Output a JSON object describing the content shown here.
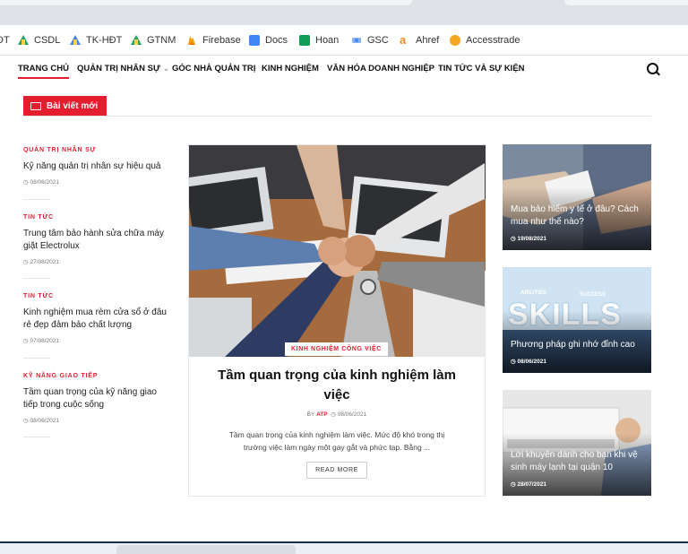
{
  "bookmarks": [
    {
      "label": "ĐT",
      "icon": "none"
    },
    {
      "label": "CSDL",
      "icon": "google-drive-icon"
    },
    {
      "label": "TK-HĐT",
      "icon": "google-drive-icon"
    },
    {
      "label": "GTNM",
      "icon": "google-drive-icon"
    },
    {
      "label": "Firebase",
      "icon": "firebase-icon"
    },
    {
      "label": "Docs",
      "icon": "docs-icon"
    },
    {
      "label": "Hoan",
      "icon": "sheets-icon"
    },
    {
      "label": "GSC",
      "icon": "search-console-icon"
    },
    {
      "label": "Ahref",
      "icon": "ahrefs-icon"
    },
    {
      "label": "Accesstrade",
      "icon": "accesstrade-icon"
    }
  ],
  "nav": {
    "items": [
      "TRANG CHỦ",
      "QUẢN TRỊ NHÂN SỰ",
      "GÓC NHÀ QUẢN TRỊ",
      "KINH NGHIỆM",
      "VĂN HÓA DOANH NGHIỆP",
      "TIN TỨC VÀ SỰ KIỆN"
    ],
    "dropdown_indicator": "⌄"
  },
  "section": {
    "title": "Bài viết mới"
  },
  "left_posts": [
    {
      "category": "QUẢN TRỊ NHÂN SỰ",
      "title": "Kỹ năng quản trị nhân sự hiệu quả",
      "date": "08/06/2021"
    },
    {
      "category": "TIN TỨC",
      "title": "Trung tâm bảo hành sửa chữa máy giặt Electrolux",
      "date": "27/08/2021"
    },
    {
      "category": "TIN TỨC",
      "title": "Kinh nghiệm mua rèm cửa sổ ở đâu rẻ đẹp đảm bảo chất lượng",
      "date": "07/08/2021"
    },
    {
      "category": "KỸ NĂNG GIAO TIẾP",
      "title": "Tầm quan trọng của kỹ năng giao tiếp trong cuộc sống",
      "date": "08/06/2021"
    }
  ],
  "featured": {
    "category": "KINH NGHIỆM CÔNG VIỆC",
    "title": "Tầm quan trọng của kinh nghiệm làm việc",
    "by": "BY",
    "author": "ATP",
    "date": "08/06/2021",
    "excerpt": "Tầm quan trọng của kinh nghiệm làm việc. Mức độ khó trong thị trường việc làm ngày một gay gắt và phức tạp. Bằng ...",
    "read_more": "READ MORE"
  },
  "side_posts": [
    {
      "title": "Mua bảo hiểm y tế ở đâu? Cách mua như thế nào?",
      "date": "19/08/2021"
    },
    {
      "title": "Phương pháp ghi nhớ đỉnh cao",
      "date": "08/06/2021",
      "image_text": "SKILLS",
      "image_tags": [
        "ABILITIES",
        "SUCCESS"
      ]
    },
    {
      "title": "Lời khuyên dành cho bạn khi vệ sinh máy lạnh tại quận 10",
      "date": "28/07/2021"
    }
  ],
  "colors": {
    "accent": "#e41e2f"
  }
}
